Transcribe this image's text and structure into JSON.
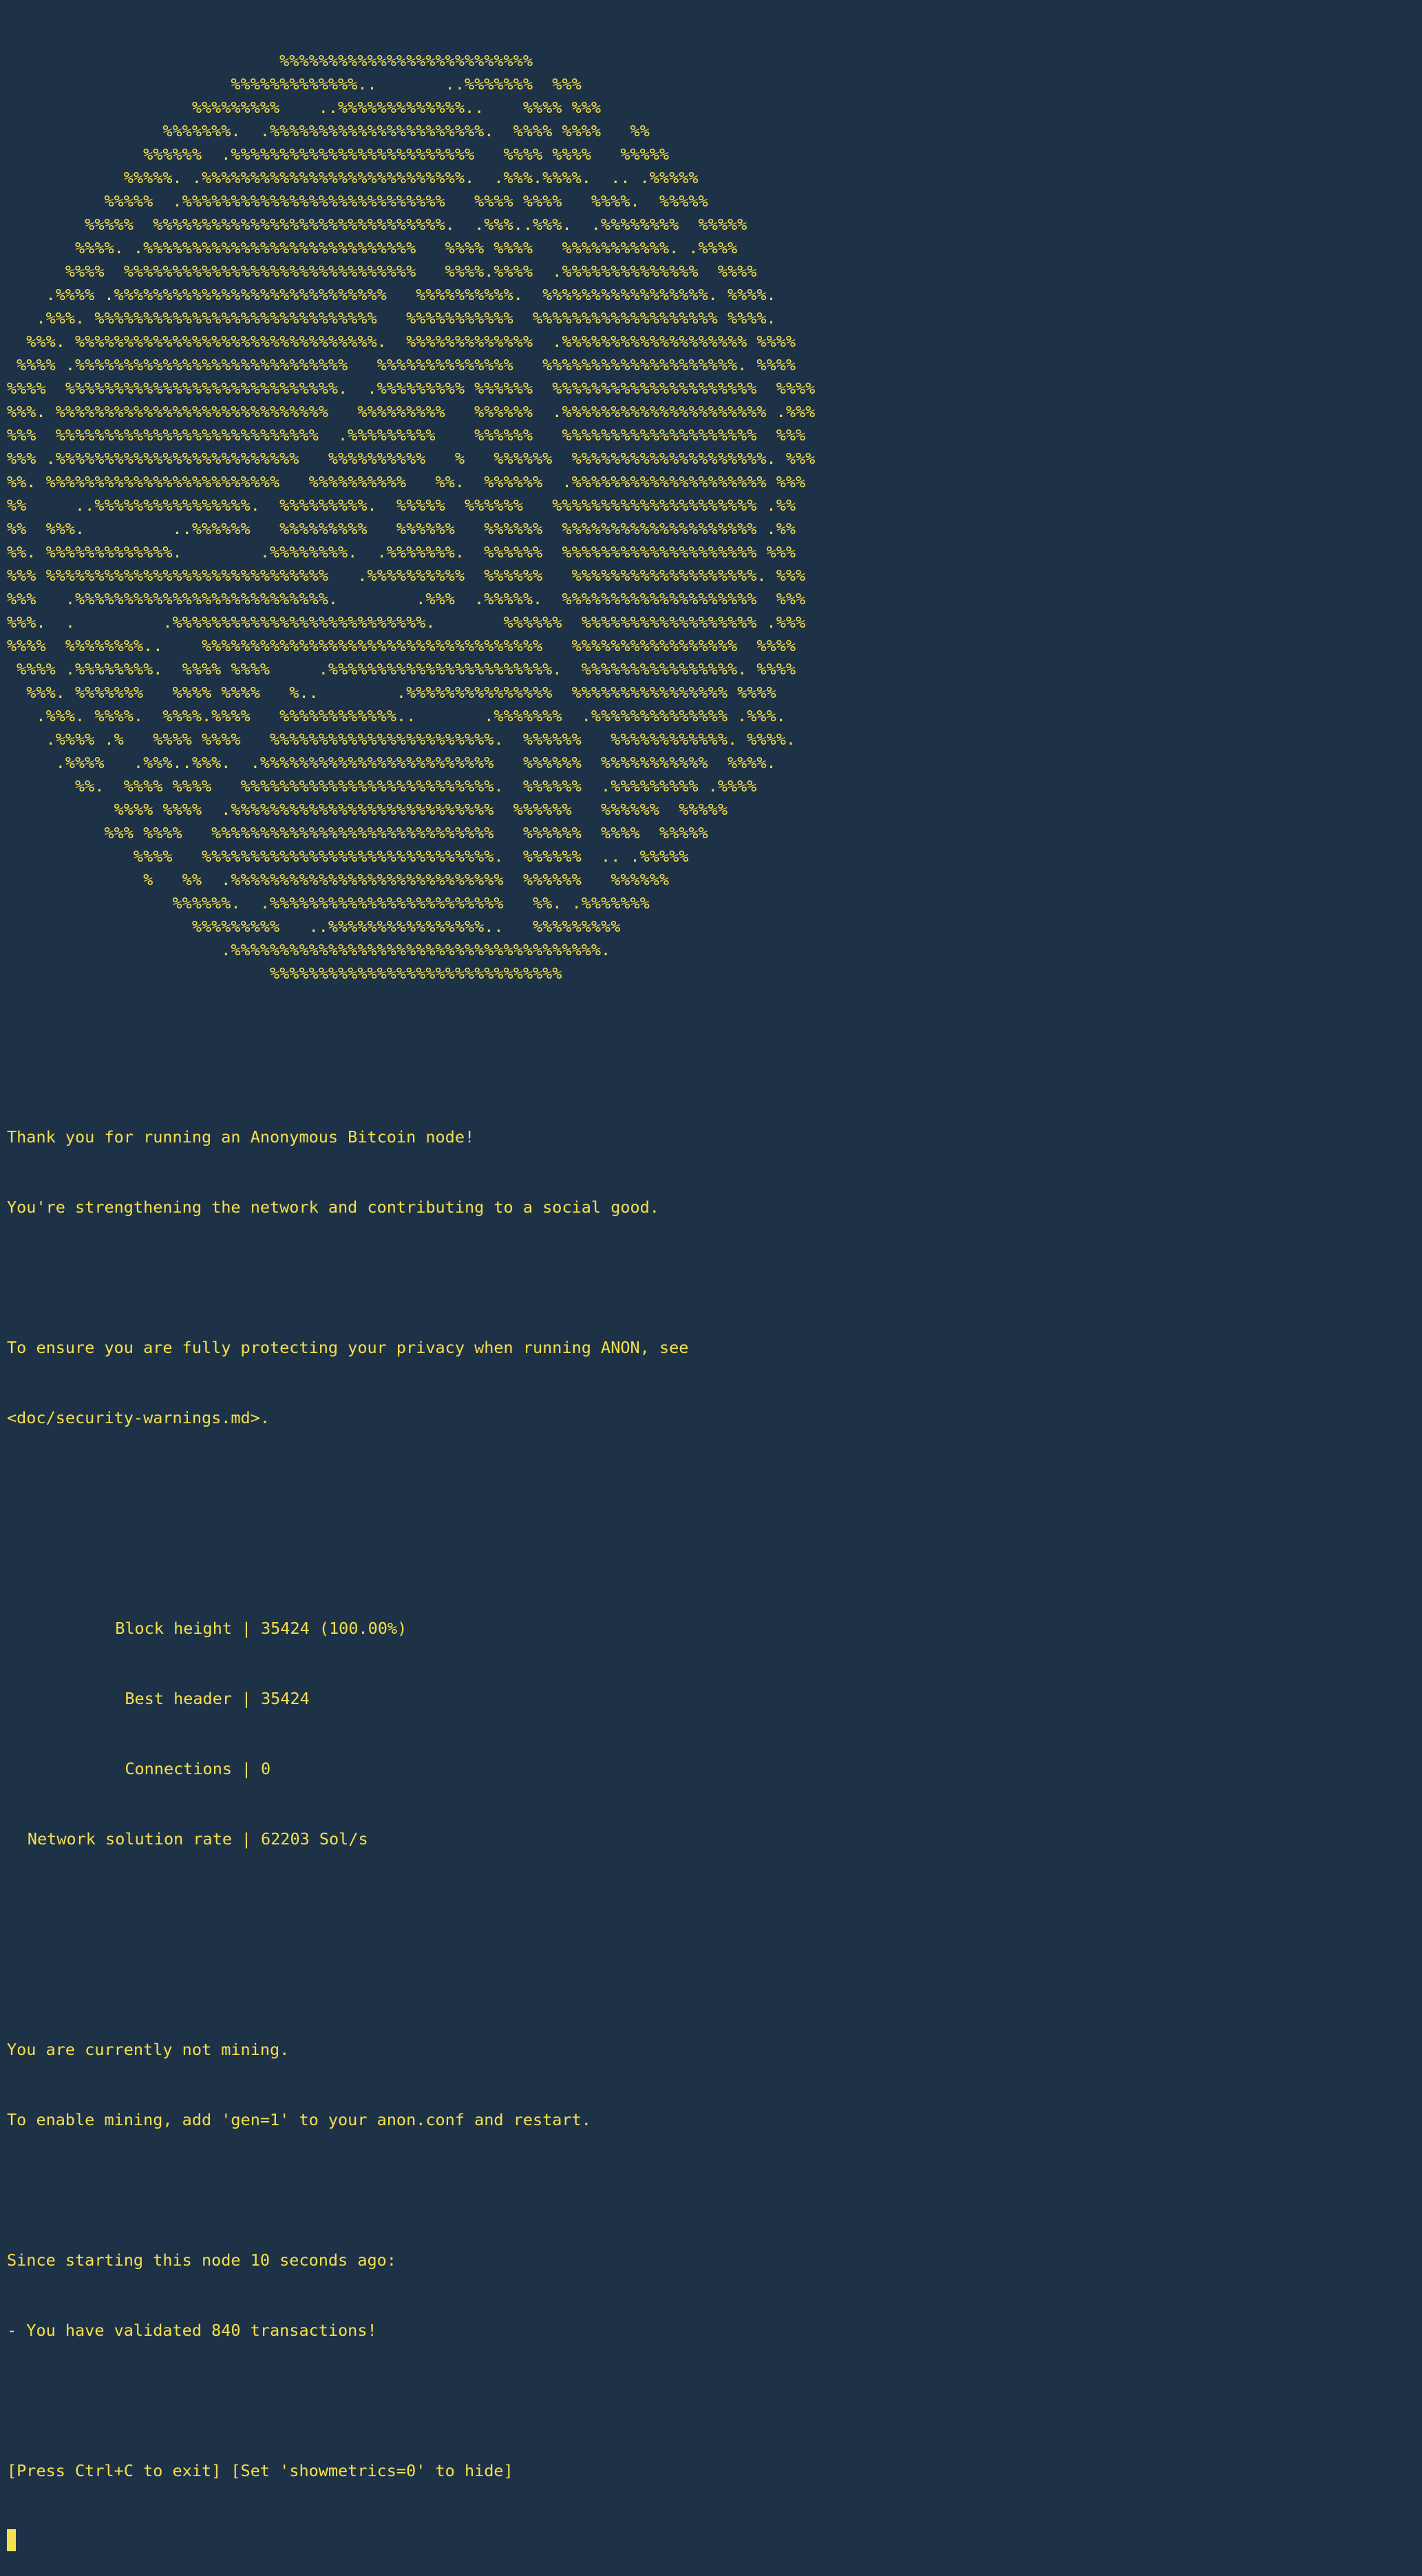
{
  "terminal": {
    "logo_lines": [
      "                            %%%%%%%%%%%%%%%%%%%%%%%%%%",
      "                       %%%%%%%%%%%%%..       ..%%%%%%%  %%%",
      "                   %%%%%%%%%    ..%%%%%%%%%%%%%..    %%%% %%%",
      "                %%%%%%%.  .%%%%%%%%%%%%%%%%%%%%%%.  %%%% %%%%   %%",
      "              %%%%%%  .%%%%%%%%%%%%%%%%%%%%%%%%%   %%%% %%%%   %%%%%",
      "            %%%%%. .%%%%%%%%%%%%%%%%%%%%%%%%%%%.  .%%%.%%%%.  .. .%%%%%",
      "          %%%%%  .%%%%%%%%%%%%%%%%%%%%%%%%%%%   %%%% %%%%   %%%%.  %%%%%",
      "        %%%%%  %%%%%%%%%%%%%%%%%%%%%%%%%%%%%%.  .%%%..%%%.  .%%%%%%%%  %%%%%",
      "       %%%%. .%%%%%%%%%%%%%%%%%%%%%%%%%%%%   %%%% %%%%   %%%%%%%%%%%. .%%%%",
      "      %%%%  %%%%%%%%%%%%%%%%%%%%%%%%%%%%%%   %%%%.%%%%  .%%%%%%%%%%%%%%  %%%%",
      "    .%%%% .%%%%%%%%%%%%%%%%%%%%%%%%%%%%   %%%%%%%%%%.  %%%%%%%%%%%%%%%%%. %%%%.",
      "   .%%%. %%%%%%%%%%%%%%%%%%%%%%%%%%%%%   %%%%%%%%%%%  %%%%%%%%%%%%%%%%%%% %%%%.",
      "  %%%. %%%%%%%%%%%%%%%%%%%%%%%%%%%%%%%.  %%%%%%%%%%%%%  .%%%%%%%%%%%%%%%%%%% %%%%",
      " %%%% .%%%%%%%%%%%%%%%%%%%%%%%%%%%%   %%%%%%%%%%%%%%   %%%%%%%%%%%%%%%%%%%%. %%%%",
      "%%%%  %%%%%%%%%%%%%%%%%%%%%%%%%%%%.  .%%%%%%%%% %%%%%%  %%%%%%%%%%%%%%%%%%%%%  %%%%",
      "%%%. %%%%%%%%%%%%%%%%%%%%%%%%%%%%   %%%%%%%%%   %%%%%%  .%%%%%%%%%%%%%%%%%%%%% .%%%",
      "%%%  %%%%%%%%%%%%%%%%%%%%%%%%%%%  .%%%%%%%%%    %%%%%%   %%%%%%%%%%%%%%%%%%%%  %%%",
      "%%% .%%%%%%%%%%%%%%%%%%%%%%%%%   %%%%%%%%%%   %   %%%%%%  %%%%%%%%%%%%%%%%%%%%. %%%",
      "%%. %%%%%%%%%%%%%%%%%%%%%%%%   %%%%%%%%%%   %%.  %%%%%%  .%%%%%%%%%%%%%%%%%%%% %%%",
      "%%     ..%%%%%%%%%%%%%%%%.  %%%%%%%%%.  %%%%%  %%%%%%   %%%%%%%%%%%%%%%%%%%%% .%%",
      "%%  %%%.         ..%%%%%%   %%%%%%%%%   %%%%%%   %%%%%%  %%%%%%%%%%%%%%%%%%%% .%%",
      "%%. %%%%%%%%%%%%%.        .%%%%%%%%.  .%%%%%%%.  %%%%%%  %%%%%%%%%%%%%%%%%%%% %%%",
      "%%% %%%%%%%%%%%%%%%%%%%%%%%%%%%%%   .%%%%%%%%%%  %%%%%%   %%%%%%%%%%%%%%%%%%%. %%%",
      "%%%   .%%%%%%%%%%%%%%%%%%%%%%%%%%.        .%%%  .%%%%%.  %%%%%%%%%%%%%%%%%%%%  %%%",
      "%%%.  .         .%%%%%%%%%%%%%%%%%%%%%%%%%%.       %%%%%%  %%%%%%%%%%%%%%%%%% .%%%",
      "%%%%  %%%%%%%%..    %%%%%%%%%%%%%%%%%%%%%%%%%%%%%%%%%%%   %%%%%%%%%%%%%%%%%  %%%%",
      " %%%% .%%%%%%%%.  %%%% %%%%     .%%%%%%%%%%%%%%%%%%%%%%%.  %%%%%%%%%%%%%%%%. %%%%",
      "  %%%. %%%%%%%   %%%% %%%%   %..        .%%%%%%%%%%%%%%%  %%%%%%%%%%%%%%%% %%%%",
      "   .%%%. %%%%.  %%%%.%%%%   %%%%%%%%%%%%..       .%%%%%%%  .%%%%%%%%%%%%%% .%%%.",
      "    .%%%% .%   %%%% %%%%   %%%%%%%%%%%%%%%%%%%%%%%.  %%%%%%   %%%%%%%%%%%%. %%%%.",
      "     .%%%%   .%%%..%%%.  .%%%%%%%%%%%%%%%%%%%%%%%%   %%%%%%  %%%%%%%%%%%  %%%%.",
      "       %%.  %%%% %%%%   %%%%%%%%%%%%%%%%%%%%%%%%%%.  %%%%%%  .%%%%%%%%% .%%%%",
      "           %%%% %%%%  .%%%%%%%%%%%%%%%%%%%%%%%%%%%  %%%%%%   %%%%%%  %%%%%",
      "          %%% %%%%   %%%%%%%%%%%%%%%%%%%%%%%%%%%%%   %%%%%%  %%%%  %%%%%",
      "             %%%%   %%%%%%%%%%%%%%%%%%%%%%%%%%%%%%.  %%%%%%  .. .%%%%%",
      "              %   %%  .%%%%%%%%%%%%%%%%%%%%%%%%%%%%  %%%%%%   %%%%%%",
      "                 %%%%%%.  .%%%%%%%%%%%%%%%%%%%%%%%%   %%. .%%%%%%%",
      "                   %%%%%%%%%   ..%%%%%%%%%%%%%%%%..   %%%%%%%%%",
      "                      .%%%%%%%%%%%%%%%%%%%%%%%%%%%%%%%%%%%%%%.",
      "                           %%%%%%%%%%%%%%%%%%%%%%%%%%%%%%"
    ],
    "thanks_line": "Thank you for running an Anonymous Bitcoin node!",
    "strengthening_line": "You're strengthening the network and contributing to a social good.",
    "privacy_line": "To ensure you are fully protecting your privacy when running ANON, see",
    "privacy_doc": "<doc/security-warnings.md>.",
    "metrics": [
      {
        "label": "Block height",
        "separator": "|",
        "value": "35424 (100.00%)"
      },
      {
        "label": "Best header",
        "separator": "|",
        "value": "35424"
      },
      {
        "label": "Connections",
        "separator": "|",
        "value": "0"
      },
      {
        "label": "Network solution rate",
        "separator": "|",
        "value": "62203 Sol/s"
      }
    ],
    "mining_status": "You are currently not mining.",
    "mining_hint": "To enable mining, add 'gen=1' to your anon.conf and restart.",
    "since_line": "Since starting this node 10 seconds ago:",
    "validated_line": "- You have validated 840 transactions!",
    "footer_line": "[Press Ctrl+C to exit] [Set 'showmetrics=0' to hide]"
  },
  "colors": {
    "background": "#1e3247",
    "text": "#f5e04d"
  }
}
